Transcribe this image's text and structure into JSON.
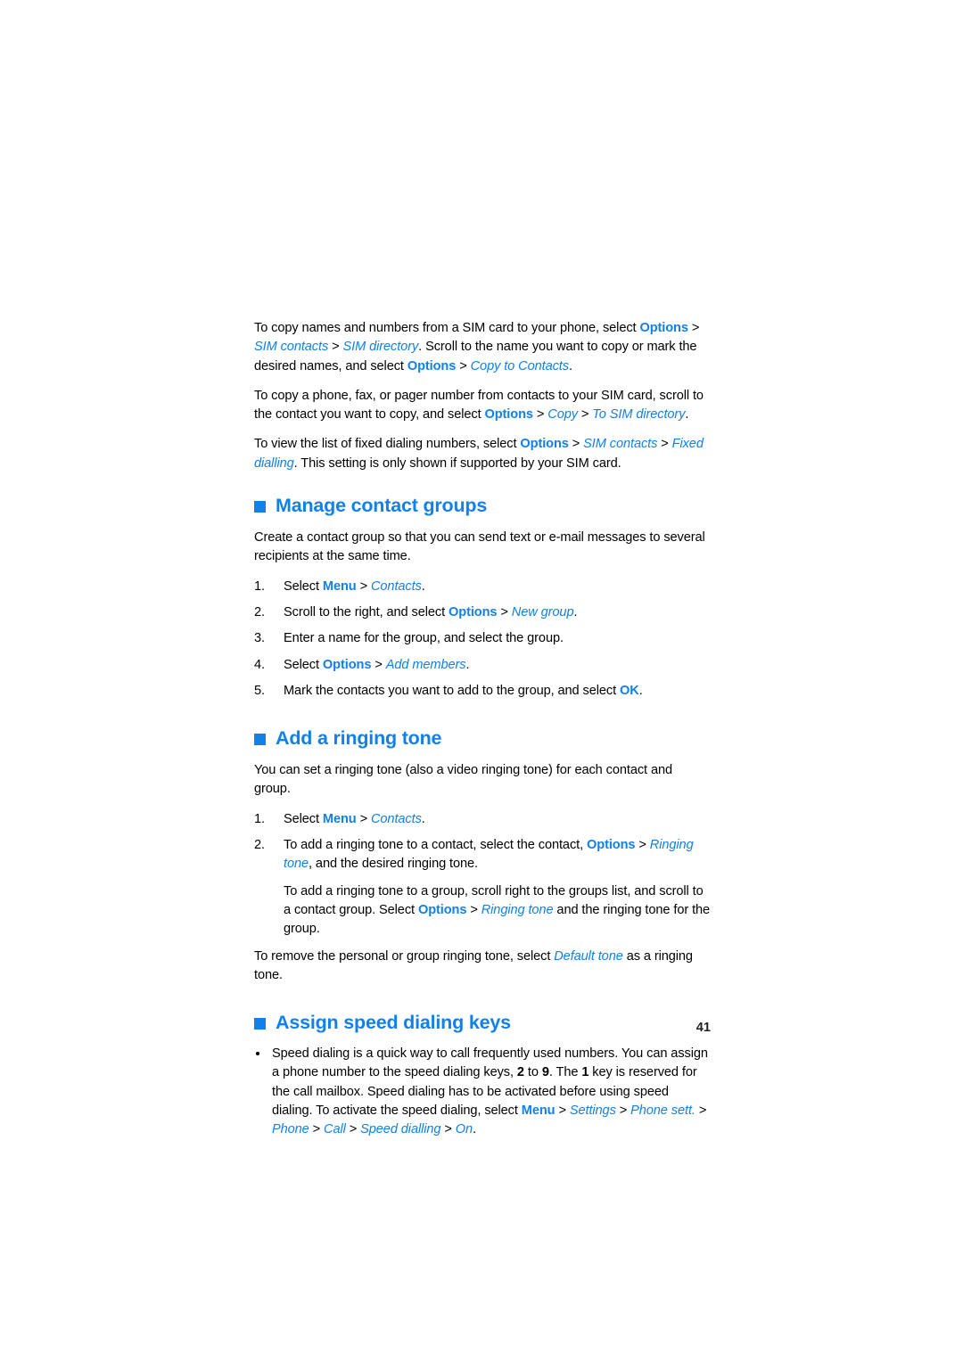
{
  "document": {
    "page_number": "41",
    "accent_color": "#1180e8",
    "text_color": "#000000"
  },
  "intro": {
    "paragraph_1": {
      "t1": "To copy names and numbers from a SIM card to your phone, select ",
      "b1": "Options",
      "s1": " > ",
      "i1": "SIM contacts",
      "s2": " > ",
      "i2": "SIM directory",
      "t2": ". Scroll to the name you want to copy or mark the desired names, and select ",
      "b2": "Options",
      "s3": " > ",
      "i3": "Copy to Contacts",
      "t3": "."
    },
    "paragraph_2": {
      "t1": "To copy a phone, fax, or pager number from contacts to your SIM card, scroll to the contact you want to copy, and select ",
      "b1": "Options",
      "s1": " > ",
      "i1": "Copy",
      "s2": " > ",
      "i2": "To SIM directory",
      "t2": "."
    },
    "paragraph_3": {
      "t1": "To view the list of fixed dialing numbers, select ",
      "b1": "Options",
      "s1": " > ",
      "i1": "SIM contacts",
      "s2": " > ",
      "i2": "Fixed dialling",
      "t2": ". This setting is only shown if supported by your SIM card."
    }
  },
  "section_manage_contact_groups": {
    "heading": "Manage contact groups",
    "intro": "Create a contact group so that you can send text or e-mail messages to several recipients at the same time.",
    "steps": [
      {
        "num": "1.",
        "t1": "Select ",
        "b1": "Menu",
        "s1": " > ",
        "i1": "Contacts",
        "t2": "."
      },
      {
        "num": "2.",
        "t1": "Scroll to the right, and select ",
        "b1": "Options",
        "s1": " > ",
        "i1": "New group",
        "t2": "."
      },
      {
        "num": "3.",
        "t1": "Enter a name for the group, and select the group.",
        "b1": "",
        "s1": "",
        "i1": "",
        "t2": ""
      },
      {
        "num": "4.",
        "t1": "Select ",
        "b1": "Options",
        "s1": " > ",
        "i1": "Add members",
        "t2": "."
      },
      {
        "num": "5.",
        "t1": "Mark the contacts you want to add to the group, and select ",
        "b1": "OK",
        "s1": "",
        "i1": "",
        "t2": "."
      }
    ]
  },
  "section_add_ringing_tone": {
    "heading": "Add a ringing tone",
    "intro": "You can set a ringing tone (also a video ringing tone) for each contact and group.",
    "step_1": {
      "num": "1.",
      "t1": "Select ",
      "b1": "Menu",
      "s1": " > ",
      "i1": "Contacts",
      "t2": "."
    },
    "step_2": {
      "num": "2.",
      "t1": "To add a ringing tone to a contact, select the contact, ",
      "b1": "Options",
      "s1": " > ",
      "i1": "Ringing tone",
      "t2": ", and the desired ringing tone.",
      "sub_t1": "To add a ringing tone to a group, scroll right to the groups list, and scroll to a contact group. Select ",
      "sub_b1": "Options",
      "sub_s1": " > ",
      "sub_i1": "Ringing tone",
      "sub_t2": " and the ringing tone for the group."
    },
    "outro": {
      "t1": "To remove the personal or group ringing tone, select ",
      "i1": "Default tone",
      "t2": " as a ringing tone."
    }
  },
  "section_assign_speed_dialing": {
    "heading": "Assign speed dialing keys",
    "bullet": {
      "t1": "Speed dialing is a quick way to call frequently used numbers. You can assign a phone number to the speed dialing keys, ",
      "n1": "2",
      "t2": " to ",
      "n2": "9",
      "t3": ". The ",
      "n3": "1",
      "t4": " key is reserved for the call mailbox. Speed dialing has to be activated before using speed dialing. To activate the speed dialing, select ",
      "b1": "Menu",
      "s1": " > ",
      "i1": "Settings",
      "s2": " > ",
      "i2": "Phone sett.",
      "s3": " > ",
      "i3": "Phone",
      "s4": " > ",
      "i4": "Call",
      "s5": " > ",
      "i5": "Speed dialling",
      "s6": " > ",
      "i6": "On",
      "t5": "."
    }
  }
}
